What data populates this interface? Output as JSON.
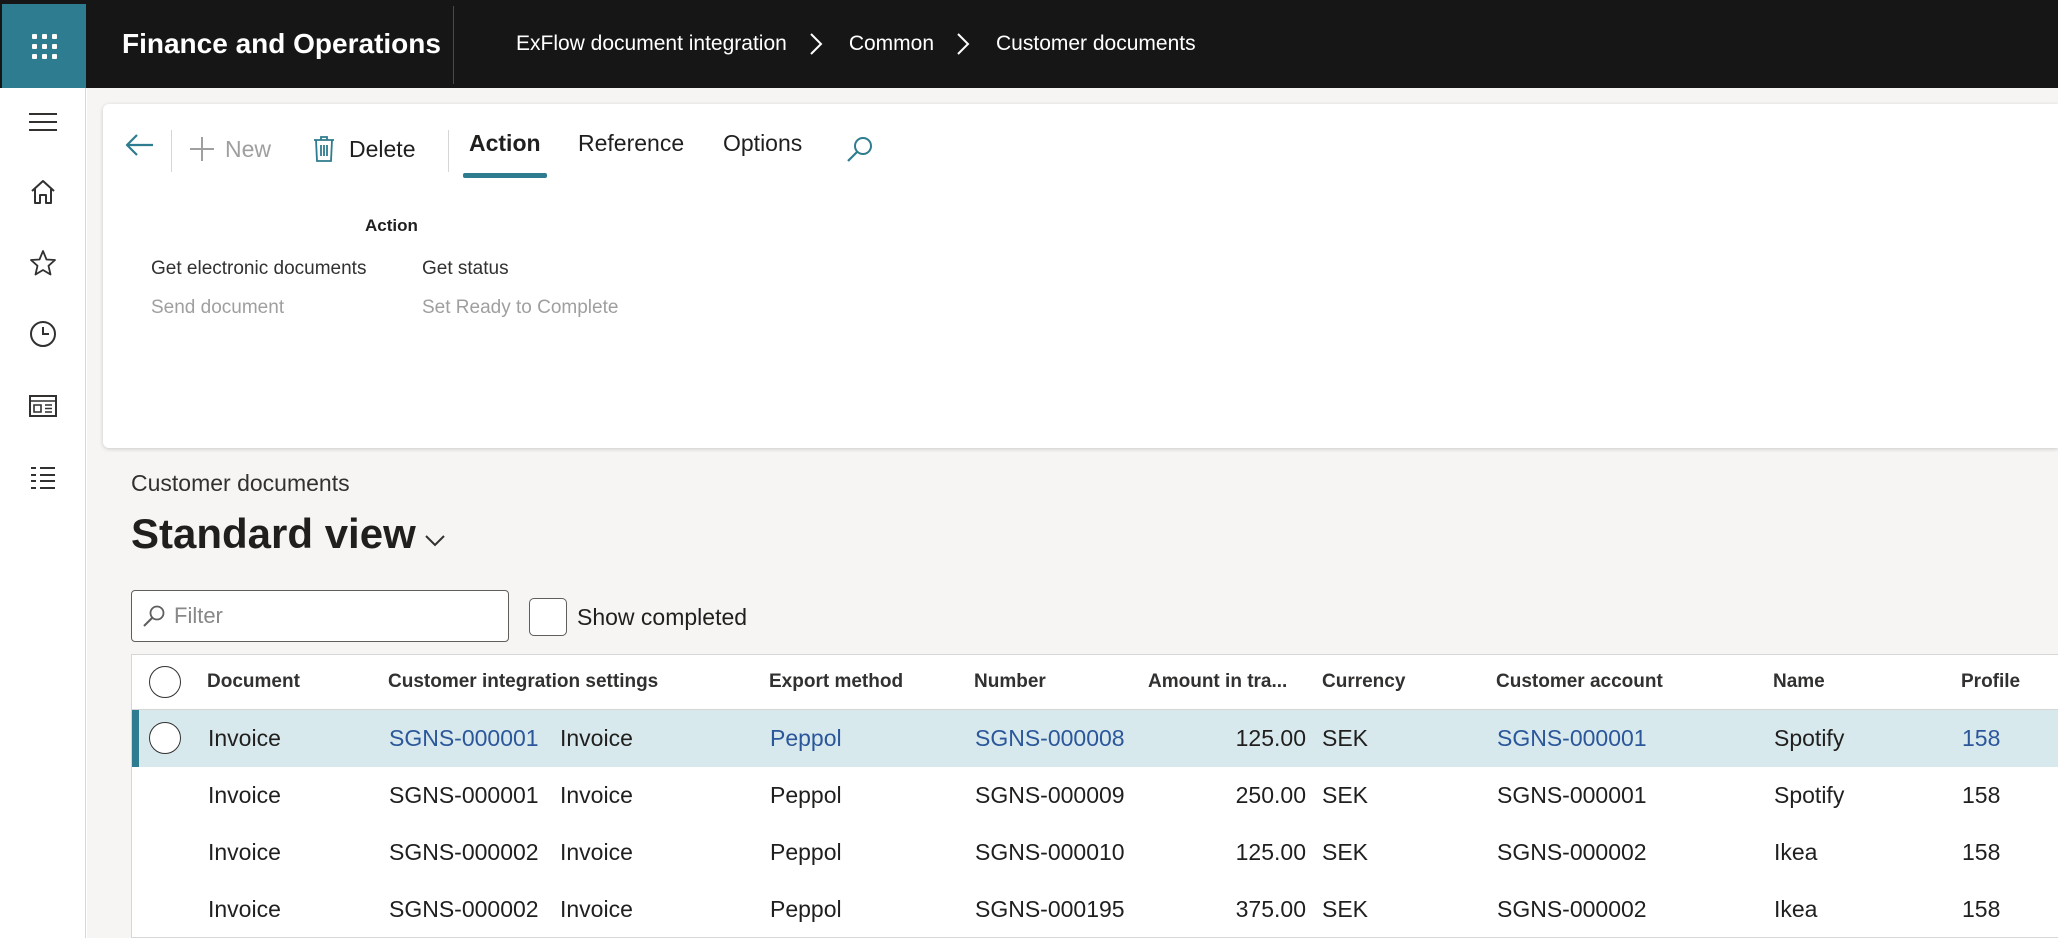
{
  "topbar": {
    "app_title": "Finance and Operations",
    "breadcrumb": [
      "ExFlow document integration",
      "Common",
      "Customer documents"
    ]
  },
  "navrail": {
    "items": [
      "menu-icon",
      "home-icon",
      "star-icon",
      "clock-icon",
      "workspace-icon",
      "modules-list-icon"
    ]
  },
  "toolbar": {
    "new_label": "New",
    "delete_label": "Delete",
    "tabs": [
      "Action",
      "Reference",
      "Options"
    ],
    "active_tab": "Action"
  },
  "action_group": {
    "title": "Action",
    "commands": [
      {
        "label": "Get electronic documents",
        "enabled": true
      },
      {
        "label": "Get status",
        "enabled": true
      },
      {
        "label": "Send document",
        "enabled": false
      },
      {
        "label": "Set Ready to Complete",
        "enabled": false
      }
    ]
  },
  "page": {
    "caption": "Customer documents",
    "view_name": "Standard view"
  },
  "filter": {
    "placeholder": "Filter",
    "show_completed_label": "Show completed",
    "show_completed_checked": false
  },
  "grid": {
    "columns": [
      "Document",
      "Customer integration settings",
      "Export method",
      "Number",
      "Amount in tra...",
      "Currency",
      "Customer account",
      "Name",
      "Profile"
    ],
    "rows": [
      {
        "document": "Invoice",
        "settings_account": "SGNS-000001",
        "settings_type": "Invoice",
        "export_method": "Peppol",
        "number": "SGNS-000008",
        "amount": "125.00",
        "currency": "SEK",
        "customer_account": "SGNS-000001",
        "name": "Spotify",
        "profile": "158",
        "selected": true
      },
      {
        "document": "Invoice",
        "settings_account": "SGNS-000001",
        "settings_type": "Invoice",
        "export_method": "Peppol",
        "number": "SGNS-000009",
        "amount": "250.00",
        "currency": "SEK",
        "customer_account": "SGNS-000001",
        "name": "Spotify",
        "profile": "158",
        "selected": false
      },
      {
        "document": "Invoice",
        "settings_account": "SGNS-000002",
        "settings_type": "Invoice",
        "export_method": "Peppol",
        "number": "SGNS-000010",
        "amount": "125.00",
        "currency": "SEK",
        "customer_account": "SGNS-000002",
        "name": "Ikea",
        "profile": "158",
        "selected": false
      },
      {
        "document": "Invoice",
        "settings_account": "SGNS-000002",
        "settings_type": "Invoice",
        "export_method": "Peppol",
        "number": "SGNS-000195",
        "amount": "375.00",
        "currency": "SEK",
        "customer_account": "SGNS-000002",
        "name": "Ikea",
        "profile": "158",
        "selected": false
      }
    ]
  },
  "colors": {
    "accent": "#2e7c8f",
    "topbar": "#161616",
    "link": "#2b579a",
    "selected_row": "#d8e9ee",
    "disabled_text": "#a19f9d"
  }
}
